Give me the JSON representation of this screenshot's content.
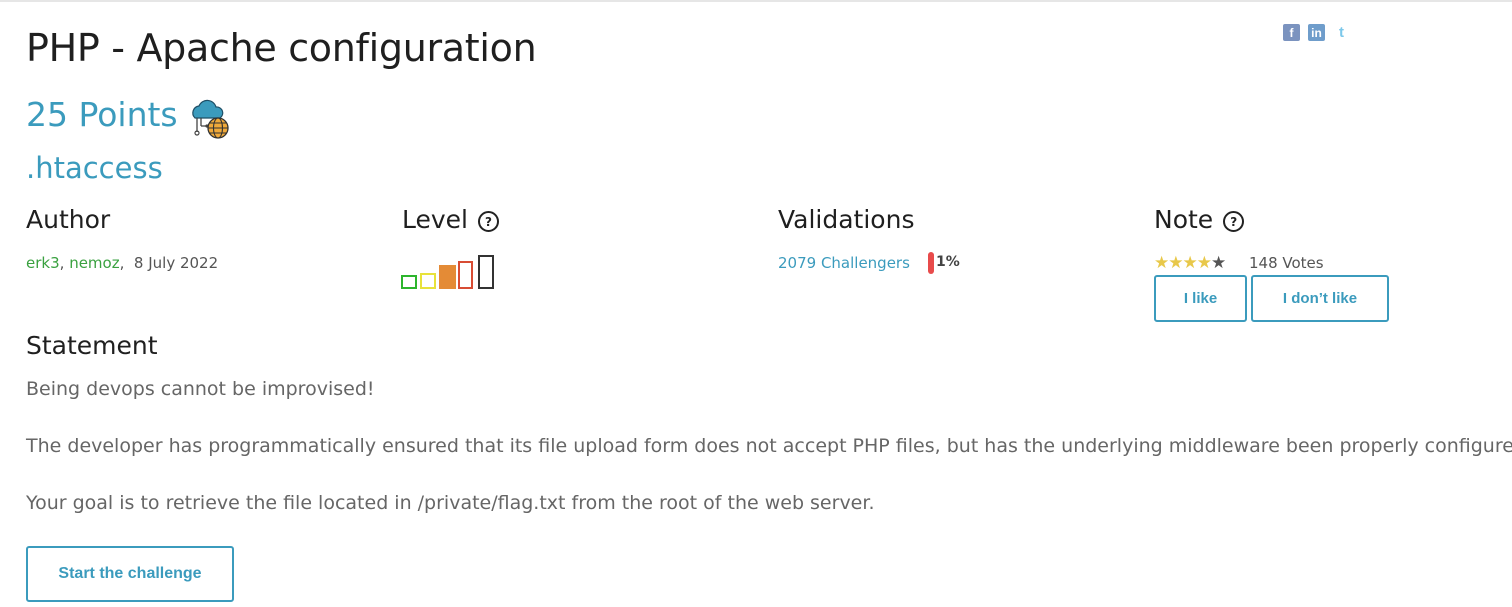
{
  "challenge": {
    "title": "PHP - Apache configuration",
    "points": "25 Points",
    "category_icon": "cloud-network-globe-icon",
    "subtitle": ".htaccess"
  },
  "social": {
    "facebook": "f",
    "linkedin": "in",
    "twitter": "t"
  },
  "author": {
    "heading": "Author",
    "names": [
      "erk3",
      "nemoz"
    ],
    "date": "8 July 2022"
  },
  "level": {
    "heading": "Level",
    "help": "?",
    "current": 4,
    "max": 5,
    "colors": [
      "#2db52d",
      "#e8e23a",
      "#e48b36",
      "#d84c34",
      "#333333"
    ]
  },
  "validations": {
    "heading": "Validations",
    "challengers": "2079 Challengers",
    "percent": "1%"
  },
  "note": {
    "heading": "Note",
    "help": "?",
    "rating": 4,
    "max": 5,
    "votes": "148 Votes",
    "like_label": "I like",
    "dislike_label": "I don’t like"
  },
  "statement": {
    "heading": "Statement",
    "paragraphs": [
      "Being devops cannot be improvised!",
      "The developer has programmatically ensured that its file upload form does not accept PHP files, but has the underlying middleware been properly configured?",
      "Your goal is to retrieve the file located in /private/flag.txt from the root of the web server."
    ]
  },
  "start_label": "Start the challenge",
  "colors": {
    "accent": "#3b9bbd",
    "author_link": "#3aa140",
    "validation_bar": "#e84b4b",
    "star_on": "#e8c84a"
  }
}
